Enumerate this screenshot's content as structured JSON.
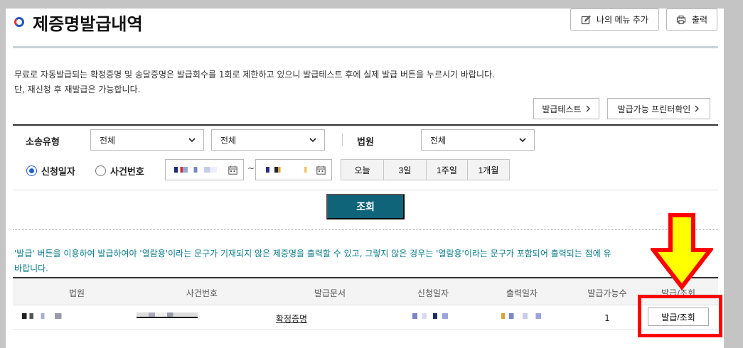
{
  "page": {
    "title": "제증명발급내역",
    "my_menu_add_label": "나의 메뉴 추가",
    "print_label": "출력"
  },
  "notice": {
    "line1": "무료로 자동발급되는 확정증명 및 송달증명은 발급회수를 1회로 제한하고 있으니 발급테스트 후에 실제 발급 버튼을 누르시기 바랍니다.",
    "line2": "단, 재신청 후 재발급은 가능합니다."
  },
  "actions": {
    "issue_test_label": "발급테스트",
    "printer_check_label": "발급가능 프린터확인"
  },
  "search": {
    "delivery_type_label": "소송유형",
    "delivery_type_value1": "전체",
    "delivery_type_value2": "전체",
    "court_label": "법원",
    "court_value": "전체",
    "radio_apply_date": "신청일자",
    "radio_case_number": "사건번호",
    "radio_selected": "신청일자",
    "date_separator": "~",
    "periods": [
      "오늘",
      "3일",
      "1주일",
      "1개월"
    ],
    "submit_label": "조회"
  },
  "teal_notice": {
    "line1": "'발급' 버튼을 이용하여 발급하여야 '열람용'이라는 문구가 기재되지 않은 제증명을 출력할 수 있고, 그렇지 않은 경우는 '열람용'이라는 문구가 포함되어 출력되는 점에 유",
    "line2": "바랍니다."
  },
  "table": {
    "headers": [
      "법원",
      "사건번호",
      "발급문서",
      "신청일자",
      "출력일자",
      "발급가능수",
      "발급/조회"
    ],
    "rows": [
      {
        "document": "확정증명",
        "available_count": "1",
        "action_label": "발급/조회"
      }
    ]
  },
  "annotation_colors": {
    "frame": "#ff0000",
    "arrow_fill": "#ffff00",
    "arrow_stroke": "#ff0000"
  },
  "icons": [
    "title-bullet-icon",
    "edit-icon",
    "print-icon",
    "chevron-right-icon",
    "chevron-down-icon",
    "calendar-icon"
  ]
}
